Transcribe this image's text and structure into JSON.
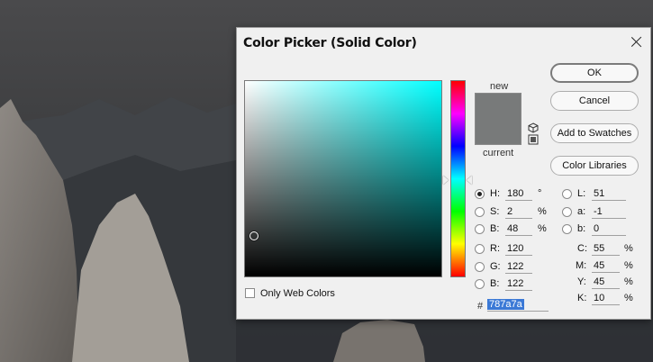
{
  "dialog": {
    "title": "Color Picker (Solid Color)",
    "colors": {
      "new": "#787a7a",
      "current": "#787a7a",
      "hue_base": "#00ffff",
      "hex_highlight": "#3b79d6"
    }
  },
  "swatch": {
    "new_label": "new",
    "current_label": "current"
  },
  "buttons": {
    "ok": "OK",
    "cancel": "Cancel",
    "add_to_swatches": "Add to Swatches",
    "color_libraries": "Color Libraries"
  },
  "web_colors": {
    "label": "Only Web Colors",
    "checked": false
  },
  "hsb": {
    "h": {
      "label": "H:",
      "value": "180",
      "unit": "°",
      "selected": true
    },
    "s": {
      "label": "S:",
      "value": "2",
      "unit": "%",
      "selected": false
    },
    "b": {
      "label": "B:",
      "value": "48",
      "unit": "%",
      "selected": false
    }
  },
  "rgb": {
    "r": {
      "label": "R:",
      "value": "120"
    },
    "g": {
      "label": "G:",
      "value": "122"
    },
    "b": {
      "label": "B:",
      "value": "122"
    }
  },
  "lab": {
    "l": {
      "label": "L:",
      "value": "51"
    },
    "a": {
      "label": "a:",
      "value": "-1"
    },
    "b": {
      "label": "b:",
      "value": "0"
    }
  },
  "cmyk": {
    "c": {
      "label": "C:",
      "value": "55",
      "unit": "%"
    },
    "m": {
      "label": "M:",
      "value": "45",
      "unit": "%"
    },
    "y": {
      "label": "Y:",
      "value": "45",
      "unit": "%"
    },
    "k": {
      "label": "K:",
      "value": "10",
      "unit": "%"
    }
  },
  "hex": {
    "symbol": "#",
    "value": "787a7a"
  },
  "icons": [
    "close-icon",
    "cube-icon",
    "web-swatch-icon"
  ]
}
